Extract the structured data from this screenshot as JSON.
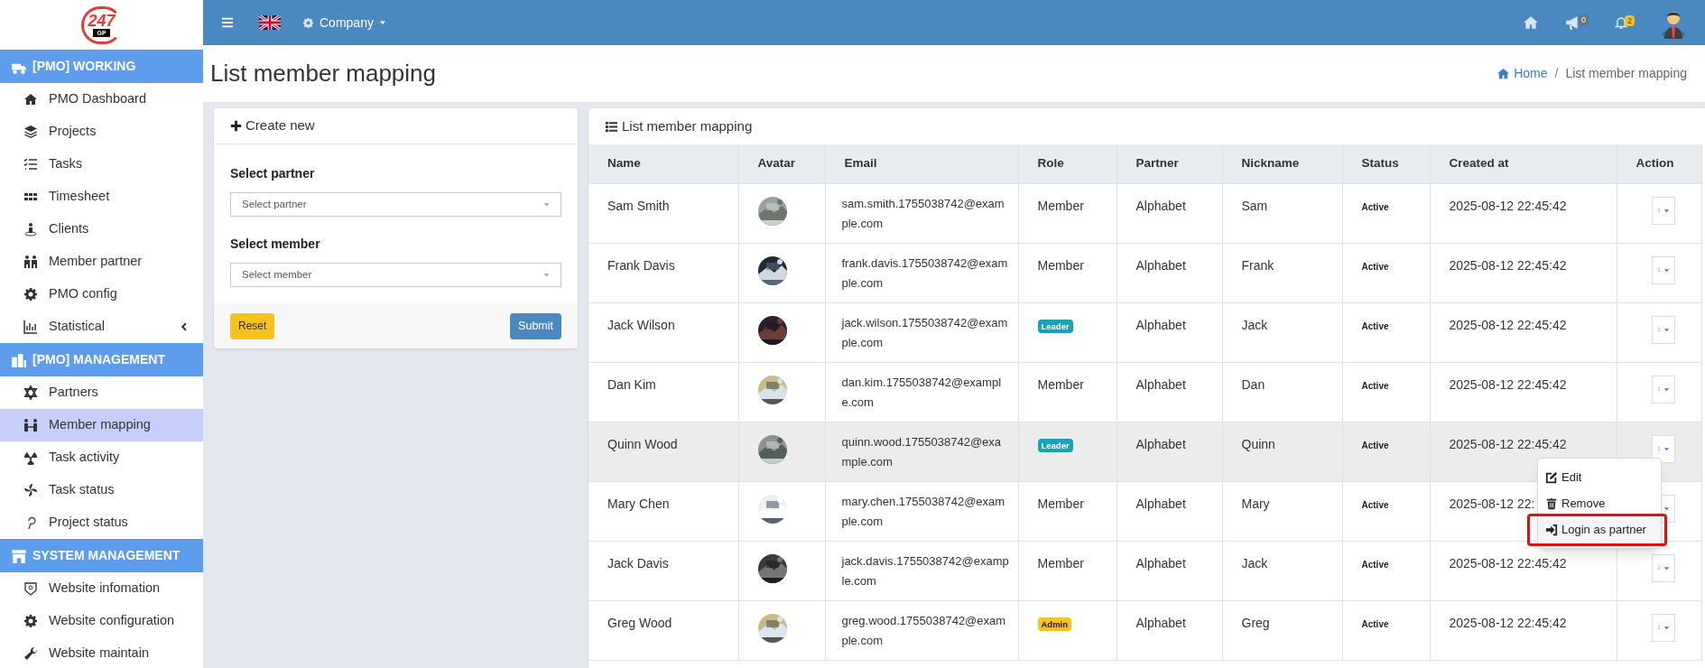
{
  "logo": {
    "text": "247",
    "subtext": "GP"
  },
  "sidebar": {
    "sections": [
      {
        "title": "[PMO] WORKING",
        "items": [
          {
            "label": "PMO Dashboard",
            "selected": false,
            "kind": "link"
          },
          {
            "label": "Projects",
            "selected": false,
            "kind": "link"
          },
          {
            "label": "Tasks",
            "selected": false,
            "kind": "link"
          },
          {
            "label": "Timesheet",
            "selected": false,
            "kind": "link"
          },
          {
            "label": "Clients",
            "selected": false,
            "kind": "link"
          },
          {
            "label": "Member partner",
            "selected": false,
            "kind": "link"
          },
          {
            "label": "PMO config",
            "selected": false,
            "kind": "link"
          },
          {
            "label": "Statistical",
            "selected": false,
            "kind": "submenu"
          }
        ]
      },
      {
        "title": "[PMO] MANAGEMENT",
        "items": [
          {
            "label": "Partners",
            "selected": false,
            "kind": "link"
          },
          {
            "label": "Member mapping",
            "selected": true,
            "kind": "link"
          },
          {
            "label": "Task activity",
            "selected": false,
            "kind": "link"
          },
          {
            "label": "Task status",
            "selected": false,
            "kind": "link"
          },
          {
            "label": "Project status",
            "selected": false,
            "kind": "link"
          }
        ]
      },
      {
        "title": "SYSTEM MANAGEMENT",
        "items": [
          {
            "label": "Website infomation",
            "selected": false,
            "kind": "link"
          },
          {
            "label": "Website configuration",
            "selected": false,
            "kind": "link"
          },
          {
            "label": "Website maintain",
            "selected": false,
            "kind": "link"
          }
        ]
      }
    ]
  },
  "topbar": {
    "company": "Company",
    "announcements": "0",
    "notifications": "2"
  },
  "page": {
    "title": "List member mapping",
    "breadcrumb": [
      "Home",
      "List member mapping"
    ],
    "separator": "/"
  },
  "create_form": {
    "title": "Create new",
    "fields": [
      {
        "label": "Select partner",
        "placeholder": "Select partner"
      },
      {
        "label": "Select member",
        "placeholder": "Select member"
      }
    ],
    "reset": "Reset",
    "submit": "Submit"
  },
  "table": {
    "title": "List member mapping",
    "columns": [
      "Name",
      "Avatar",
      "Email",
      "Role",
      "Partner",
      "Nickname",
      "Status",
      "Created at",
      "Action"
    ],
    "rows": [
      {
        "name": "Sam Smith",
        "email": "sam.smith.1755038742@example.com",
        "role": {
          "text": "Member",
          "kind": "text"
        },
        "partner": "Alphabet",
        "nickname": "Sam",
        "status": "Active",
        "created_at": "2025-08-12 22:45:42",
        "hovered": false,
        "menu_open": false
      },
      {
        "name": "Frank Davis",
        "email": "frank.davis.1755038742@example.com",
        "role": {
          "text": "Member",
          "kind": "text"
        },
        "partner": "Alphabet",
        "nickname": "Frank",
        "status": "Active",
        "created_at": "2025-08-12 22:45:42",
        "hovered": false,
        "menu_open": false
      },
      {
        "name": "Jack Wilson",
        "email": "jack.wilson.1755038742@example.com",
        "role": {
          "text": "Leader",
          "kind": "badge",
          "color": "#17a2b8"
        },
        "partner": "Alphabet",
        "nickname": "Jack",
        "status": "Active",
        "created_at": "2025-08-12 22:45:42",
        "hovered": false,
        "menu_open": false
      },
      {
        "name": "Dan Kim",
        "email": "dan.kim.1755038742@example.com",
        "role": {
          "text": "Member",
          "kind": "text"
        },
        "partner": "Alphabet",
        "nickname": "Dan",
        "status": "Active",
        "created_at": "2025-08-12 22:45:42",
        "hovered": false,
        "menu_open": false
      },
      {
        "name": "Quinn Wood",
        "email": "quinn.wood.1755038742@example.com",
        "role": {
          "text": "Leader",
          "kind": "badge",
          "color": "#17a2b8"
        },
        "partner": "Alphabet",
        "nickname": "Quinn",
        "status": "Active",
        "created_at": "2025-08-12 22:45:42",
        "hovered": true,
        "menu_open": true
      },
      {
        "name": "Mary Chen",
        "email": "mary.chen.1755038742@example.com",
        "role": {
          "text": "Member",
          "kind": "text"
        },
        "partner": "Alphabet",
        "nickname": "Mary",
        "status": "Active",
        "created_at": "2025-08-12 22:",
        "hovered": false,
        "menu_open": false
      },
      {
        "name": "Jack Davis",
        "email": "jack.davis.1755038742@example.com",
        "role": {
          "text": "Member",
          "kind": "text"
        },
        "partner": "Alphabet",
        "nickname": "Jack",
        "status": "Active",
        "created_at": "2025-08-12 22:45:42",
        "hovered": false,
        "menu_open": false
      },
      {
        "name": "Greg Wood",
        "email": "greg.wood.1755038742@example.com",
        "role": {
          "text": "Admin",
          "kind": "badge",
          "color": "#f6c21c"
        },
        "partner": "Alphabet",
        "nickname": "Greg",
        "status": "Active",
        "created_at": "2025-08-12 22:45:42",
        "hovered": false,
        "menu_open": false
      }
    ]
  },
  "action_menu": {
    "items": [
      {
        "label": "Edit",
        "selected": false,
        "outlined": false
      },
      {
        "label": "Remove",
        "selected": false,
        "outlined": false
      },
      {
        "label": "Login as partner",
        "selected": true,
        "outlined": true
      }
    ]
  }
}
